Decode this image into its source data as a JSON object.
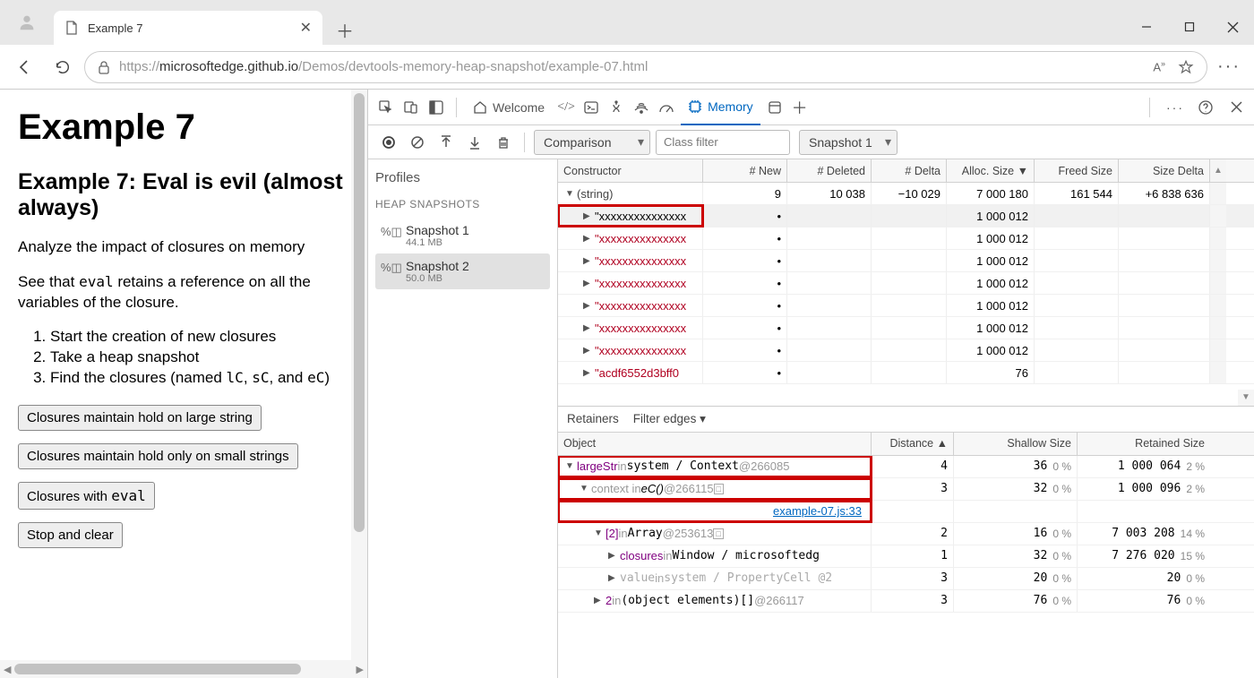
{
  "window": {
    "tab_title": "Example 7",
    "url_prefix": "https://",
    "url_main": "microsoftedge.github.io",
    "url_path": "/Demos/devtools-memory-heap-snapshot/example-07.html"
  },
  "page": {
    "h1": "Example 7",
    "h2": "Example 7: Eval is evil (almost always)",
    "p1": "Analyze the impact of closures on memory",
    "p2_a": "See that ",
    "p2_code": "eval",
    "p2_b": " retains a reference on all the variables of the closure.",
    "steps": [
      "Start the creation of new closures",
      "Take a heap snapshot"
    ],
    "step3_a": "Find the closures (named ",
    "step3_c1": "lC",
    "step3_sep1": ", ",
    "step3_c2": "sC",
    "step3_sep2": ", and ",
    "step3_c3": "eC",
    "step3_end": ")",
    "btn1": "Closures maintain hold on large string",
    "btn2": "Closures maintain hold only on small strings",
    "btn3_a": "Closures with ",
    "btn3_code": "eval",
    "btn4": "Stop and clear"
  },
  "devtools": {
    "welcome": "Welcome",
    "memory": "Memory",
    "toolbar": {
      "view": "Comparison",
      "filter_placeholder": "Class filter",
      "baseline": "Snapshot 1"
    },
    "sidebar": {
      "profiles": "Profiles",
      "heap_snapshots": "HEAP SNAPSHOTS",
      "snapshots": [
        {
          "name": "Snapshot 1",
          "size": "44.1 MB"
        },
        {
          "name": "Snapshot 2",
          "size": "50.0 MB"
        }
      ]
    },
    "headers": {
      "constructor": "Constructor",
      "new": "# New",
      "deleted": "# Deleted",
      "delta": "# Delta",
      "alloc": "Alloc. Size",
      "freed": "Freed Size",
      "sizedelta": "Size Delta"
    },
    "rows": [
      {
        "label": "(string)",
        "tri": "▼",
        "color": "#444",
        "new": "9",
        "del": "10 038",
        "delta": "−10 029",
        "alloc": "7 000 180",
        "freed": "161 544",
        "szd": "+6 838 636"
      },
      {
        "label": "\"xxxxxxxxxxxxxxx",
        "tri": "▶",
        "color": "#000",
        "new": "•",
        "alloc": "1 000 012",
        "highlight": true,
        "selected": true,
        "indent": 1
      },
      {
        "label": "\"xxxxxxxxxxxxxxx",
        "tri": "▶",
        "color": "red",
        "new": "•",
        "alloc": "1 000 012",
        "indent": 1
      },
      {
        "label": "\"xxxxxxxxxxxxxxx",
        "tri": "▶",
        "color": "red",
        "new": "•",
        "alloc": "1 000 012",
        "indent": 1
      },
      {
        "label": "\"xxxxxxxxxxxxxxx",
        "tri": "▶",
        "color": "red",
        "new": "•",
        "alloc": "1 000 012",
        "indent": 1
      },
      {
        "label": "\"xxxxxxxxxxxxxxx",
        "tri": "▶",
        "color": "red",
        "new": "•",
        "alloc": "1 000 012",
        "indent": 1
      },
      {
        "label": "\"xxxxxxxxxxxxxxx",
        "tri": "▶",
        "color": "red",
        "new": "•",
        "alloc": "1 000 012",
        "indent": 1
      },
      {
        "label": "\"xxxxxxxxxxxxxxx",
        "tri": "▶",
        "color": "red",
        "new": "•",
        "alloc": "1 000 012",
        "indent": 1
      },
      {
        "label": "\"acdf6552d3bff0",
        "tri": "▶",
        "color": "red",
        "new": "•",
        "alloc": "76",
        "indent": 1
      }
    ],
    "retainers": {
      "tab1": "Retainers",
      "tab2": "Filter edges",
      "headers": {
        "object": "Object",
        "distance": "Distance",
        "shallow": "Shallow Size",
        "retained": "Retained Size"
      },
      "rows": [
        {
          "txt": "largeStr in system / Context @266085",
          "tri": "▼",
          "ind": 0,
          "hl": true,
          "dist": "4",
          "sh": "36",
          "shp": "0 %",
          "ret": "1 000 064",
          "retp": "2 %"
        },
        {
          "txt": "context in eC() @266115",
          "tri": "▼",
          "ind": 1,
          "hl": true,
          "dist": "3",
          "sh": "32",
          "shp": "0 %",
          "ret": "1 000 096",
          "retp": "2 %",
          "link": "example-07.js:33"
        },
        {
          "txt": "[2] in Array @253613",
          "tri": "▼",
          "ind": 2,
          "dist": "2",
          "sh": "16",
          "shp": "0 %",
          "ret": "7 003 208",
          "retp": "14 %"
        },
        {
          "txt": "closures in Window / microsoftedg",
          "tri": "▶",
          "ind": 3,
          "dist": "1",
          "sh": "32",
          "shp": "0 %",
          "ret": "7 276 020",
          "retp": "15 %"
        },
        {
          "txt": "value in system / PropertyCell @2",
          "tri": "▶",
          "ind": 3,
          "dim": true,
          "dist": "3",
          "sh": "20",
          "shp": "0 %",
          "ret": "20",
          "retp": "0 %"
        },
        {
          "txt": "2 in (object elements)[] @266117",
          "tri": "▶",
          "ind": 2,
          "dist": "3",
          "sh": "76",
          "shp": "0 %",
          "ret": "76",
          "retp": "0 %"
        }
      ]
    }
  }
}
